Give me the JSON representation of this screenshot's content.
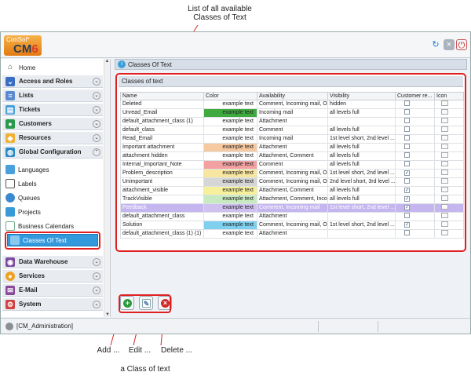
{
  "callouts": {
    "top_line1": "List of all available",
    "top_line2": "Classes of Text",
    "add": "Add ...",
    "edit": "Edit ...",
    "delete": "Delete ...",
    "footer": "a Class of text"
  },
  "logo": {
    "line1": "ConSol*",
    "cm": "CM",
    "six": "6"
  },
  "sidebar": {
    "home": "Home",
    "top_items": [
      {
        "label": "Access and Roles"
      },
      {
        "label": "Lists"
      },
      {
        "label": "Tickets"
      },
      {
        "label": "Customers"
      },
      {
        "label": "Resources"
      },
      {
        "label": "Global Configuration"
      }
    ],
    "sub_items": [
      {
        "label": "Languages"
      },
      {
        "label": "Labels"
      },
      {
        "label": "Queues"
      },
      {
        "label": "Projects"
      },
      {
        "label": "Business Calendars"
      },
      {
        "label": "Classes Of Text"
      }
    ],
    "bottom_items": [
      {
        "label": "Data Warehouse"
      },
      {
        "label": "Services"
      },
      {
        "label": "E-Mail"
      },
      {
        "label": "System"
      }
    ]
  },
  "content": {
    "title": "Classes Of Text",
    "panel_header": "Classes of text",
    "columns": [
      "Name",
      "Color",
      "Availability",
      "Visibility",
      "Customer re...",
      "Icon"
    ],
    "rows": [
      {
        "name": "Deleted",
        "color_text": "example text",
        "color": "#ffffff",
        "availability": "Comment, Incoming mail, Out...",
        "visibility": "hidden",
        "customer": false
      },
      {
        "name": "Unread_Email",
        "color_text": "example text",
        "color": "#3faa3f",
        "availability": "Incoming mail",
        "visibility": "all levels full",
        "customer": false
      },
      {
        "name": "default_attachment_class (1)",
        "color_text": "example text",
        "color": "#ffffff",
        "availability": "Attachment",
        "visibility": "",
        "customer": false
      },
      {
        "name": "default_class",
        "color_text": "example text",
        "color": "#ffffff",
        "availability": "Comment",
        "visibility": "all levels full",
        "customer": false
      },
      {
        "name": "Read_Email",
        "color_text": "example text",
        "color": "#ffffff",
        "availability": "Incoming mail",
        "visibility": "1st level short, 2nd level ...",
        "customer": false
      },
      {
        "name": "Important attachment",
        "color_text": "example text",
        "color": "#f7c9a0",
        "availability": "Attachment",
        "visibility": "all levels full",
        "customer": false
      },
      {
        "name": "attachment hidden",
        "color_text": "example text",
        "color": "#ffffff",
        "availability": "Attachment, Comment",
        "visibility": "all levels full",
        "customer": false
      },
      {
        "name": "Internal_Important_Note",
        "color_text": "example text",
        "color": "#f2a0a0",
        "availability": "Comment",
        "visibility": "all levels full",
        "customer": false
      },
      {
        "name": "Problem_description",
        "color_text": "example text",
        "color": "#f8e6a0",
        "availability": "Comment, Incoming mail, Out...",
        "visibility": "1st level short, 2nd level ...",
        "customer": true
      },
      {
        "name": "Unimportant",
        "color_text": "example text",
        "color": "#d6d6d6",
        "availability": "Comment, Incoming mail, Out...",
        "visibility": "2nd level short, 3rd level ...",
        "customer": false
      },
      {
        "name": "attachment_visible",
        "color_text": "example text",
        "color": "#f6f09a",
        "availability": "Attachment, Comment",
        "visibility": "all levels full",
        "customer": true
      },
      {
        "name": "TrackVisible",
        "color_text": "example text",
        "color": "#c8eac0",
        "availability": "Attachment, Comment, Inco...",
        "visibility": "all levels full",
        "customer": true
      },
      {
        "name": "Feedback",
        "color_text": "example text",
        "color": "#cfc0f0",
        "availability": "Comment, Incoming mail",
        "visibility": "1st level short, 2nd level ...",
        "customer": true
      },
      {
        "name": "default_attachment_class",
        "color_text": "example text",
        "color": "#ffffff",
        "availability": "Attachment",
        "visibility": "",
        "customer": false
      },
      {
        "name": "Solution",
        "color_text": "example text",
        "color": "#7fd0ee",
        "availability": "Comment, Incoming mail, Out...",
        "visibility": "1st level short, 2nd level ...",
        "customer": true
      },
      {
        "name": "default_attachment_class (1) (1)",
        "color_text": "example text",
        "color": "#ffffff",
        "availability": "Attachment",
        "visibility": "",
        "customer": false
      }
    ],
    "selected_row": "Feedback"
  },
  "status": {
    "user": "[CM_Administration]"
  }
}
